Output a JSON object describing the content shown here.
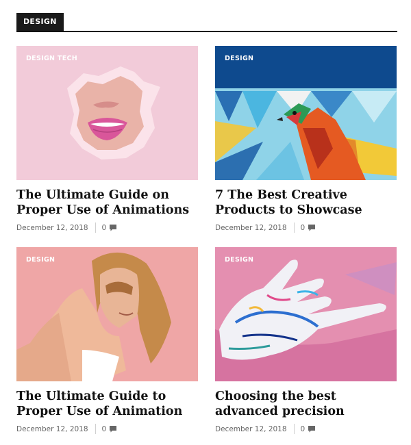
{
  "section": {
    "label": "DESIGN"
  },
  "posts": [
    {
      "category": "DESIGN TECH",
      "title": "The Ultimate Guide on Proper Use of Animations",
      "date": "December 12, 2018",
      "comments": "0"
    },
    {
      "category": "DESIGN",
      "title": "7 The Best Creative Products to Showcase",
      "date": "December 12, 2018",
      "comments": "0"
    },
    {
      "category": "DESIGN",
      "title": "The Ultimate Guide to Proper Use of Animation",
      "date": "December 12, 2018",
      "comments": "0"
    },
    {
      "category": "DESIGN",
      "title": "Choosing the best advanced precision",
      "date": "December 12, 2018",
      "comments": "0"
    }
  ],
  "icons": {
    "comment": "comment-icon"
  },
  "colors": {
    "header_bg": "#1a1a1a",
    "meta_text": "#666666"
  }
}
